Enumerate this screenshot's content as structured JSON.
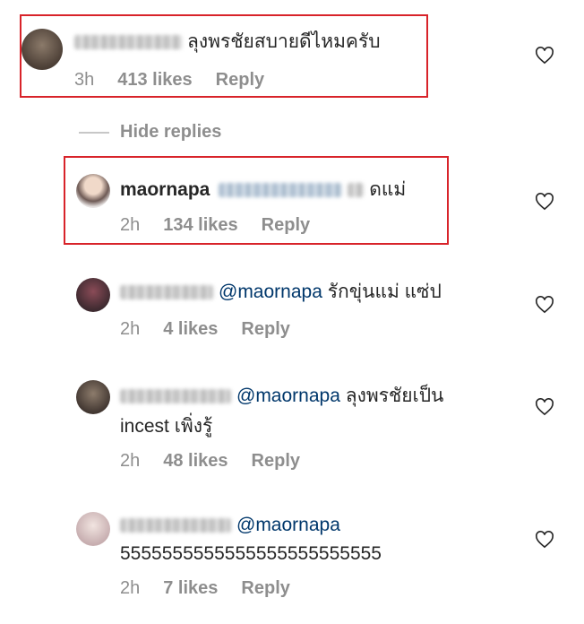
{
  "colors": {
    "highlight": "#d8232a",
    "mention": "#00376b",
    "meta": "#8e8e8e"
  },
  "hide_replies": "Hide replies",
  "comments": [
    {
      "username": "",
      "mention": "",
      "text": "ลุงพรชัยสบายดีไหมครับ",
      "time": "3h",
      "likes": "413 likes",
      "reply": "Reply"
    },
    {
      "username": "maornapa",
      "mention": "",
      "text": "ดแม่",
      "time": "2h",
      "likes": "134 likes",
      "reply": "Reply"
    },
    {
      "username": "",
      "mention": "@maornapa",
      "text": "รักขุ่นแม่ แซ่ป",
      "time": "2h",
      "likes": "4 likes",
      "reply": "Reply"
    },
    {
      "username": "",
      "mention": "@maornapa",
      "text": "ลุงพรชัยเป็น",
      "text2": "incest เพิ่งรู้",
      "time": "2h",
      "likes": "48 likes",
      "reply": "Reply"
    },
    {
      "username": "",
      "mention": "@maornapa",
      "text": "5555555555555555555555555",
      "time": "2h",
      "likes": "7 likes",
      "reply": "Reply"
    }
  ]
}
